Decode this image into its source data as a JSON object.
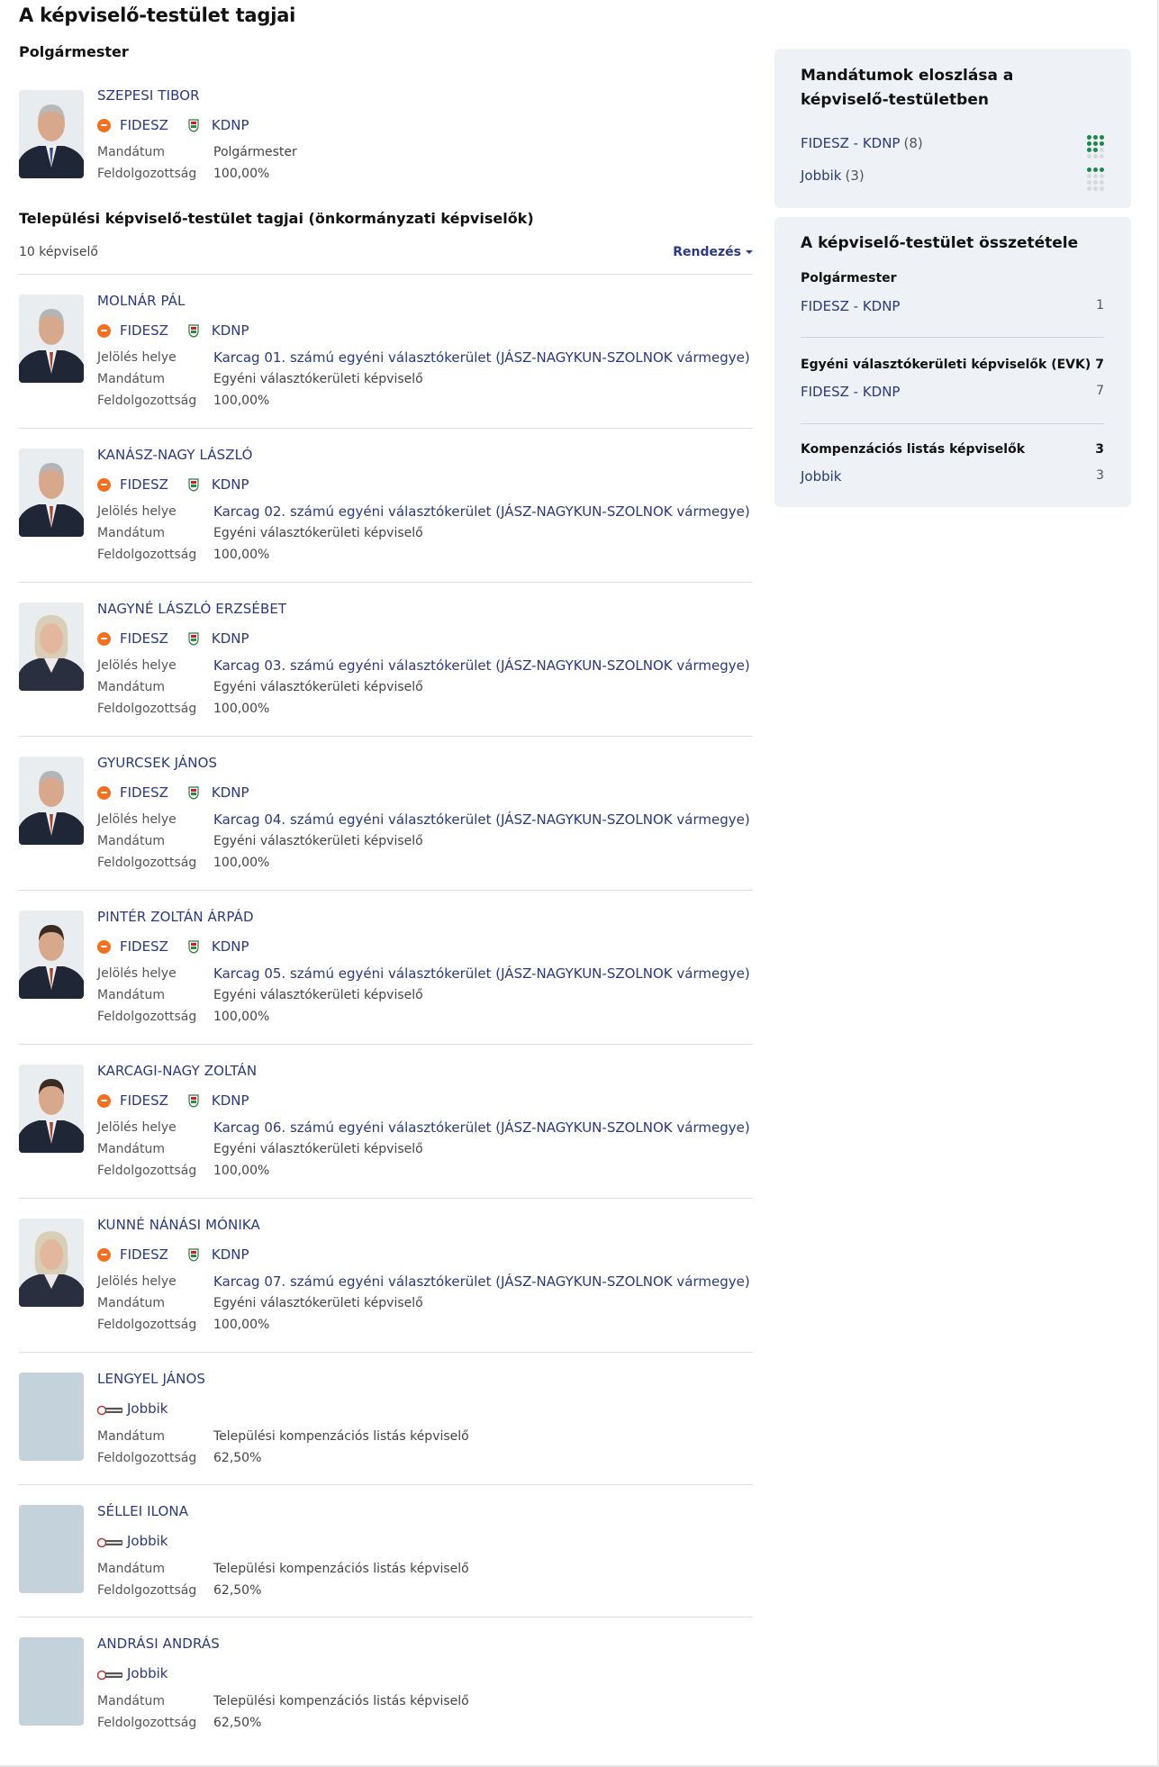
{
  "page": {
    "title": "A képviselő-testület tagjai"
  },
  "mayor_section": {
    "title": "Polgármester",
    "member": {
      "name": "SZEPESI TIBOR",
      "parties": [
        "FIDESZ",
        "KDNP"
      ],
      "mandate_label": "Mandátum",
      "mandate": "Polgármester",
      "processed_label": "Feldolgozottság",
      "processed": "100,00%"
    }
  },
  "council_section": {
    "title": "Települési képviselő-testület tagjai (önkormányzati képviselők)",
    "count_text": "10 képviselő",
    "sort_label": "Rendezés",
    "labels": {
      "nomination": "Jelölés helye",
      "mandate": "Mandátum",
      "processed": "Feldolgozottság"
    },
    "members": [
      {
        "name": "MOLNÁR PÁL",
        "parties": [
          "FIDESZ",
          "KDNP"
        ],
        "nomination": "Karcag 01. számú egyéni választókerület (JÁSZ-NAGYKUN-SZOLNOK vármegye)",
        "mandate": "Egyéni választókerületi képviselő",
        "processed": "100,00%",
        "avatar": "man-grey-hair"
      },
      {
        "name": "KANÁSZ-NAGY LÁSZLÓ",
        "parties": [
          "FIDESZ",
          "KDNP"
        ],
        "nomination": "Karcag 02. számú egyéni választókerület (JÁSZ-NAGYKUN-SZOLNOK vármegye)",
        "mandate": "Egyéni választókerületi képviselő",
        "processed": "100,00%",
        "avatar": "man-grey-hair"
      },
      {
        "name": "NAGYNÉ LÁSZLÓ ERZSÉBET",
        "parties": [
          "FIDESZ",
          "KDNP"
        ],
        "nomination": "Karcag 03. számú egyéni választókerület (JÁSZ-NAGYKUN-SZOLNOK vármegye)",
        "mandate": "Egyéni választókerületi képviselő",
        "processed": "100,00%",
        "avatar": "woman-blonde"
      },
      {
        "name": "GYURCSEK JÁNOS",
        "parties": [
          "FIDESZ",
          "KDNP"
        ],
        "nomination": "Karcag 04. számú egyéni választókerület (JÁSZ-NAGYKUN-SZOLNOK vármegye)",
        "mandate": "Egyéni választókerületi képviselő",
        "processed": "100,00%",
        "avatar": "man-grey-hair"
      },
      {
        "name": "PINTÉR ZOLTÁN ÁRPÁD",
        "parties": [
          "FIDESZ",
          "KDNP"
        ],
        "nomination": "Karcag 05. számú egyéni választókerület (JÁSZ-NAGYKUN-SZOLNOK vármegye)",
        "mandate": "Egyéni választókerületi képviselő",
        "processed": "100,00%",
        "avatar": "man-dark-hair"
      },
      {
        "name": "KARCAGI-NAGY ZOLTÁN",
        "parties": [
          "FIDESZ",
          "KDNP"
        ],
        "nomination": "Karcag 06. számú egyéni választókerület (JÁSZ-NAGYKUN-SZOLNOK vármegye)",
        "mandate": "Egyéni választókerületi képviselő",
        "processed": "100,00%",
        "avatar": "man-dark-hair"
      },
      {
        "name": "KUNNÉ NÁNÁSI MÓNIKA",
        "parties": [
          "FIDESZ",
          "KDNP"
        ],
        "nomination": "Karcag 07. számú egyéni választókerület (JÁSZ-NAGYKUN-SZOLNOK vármegye)",
        "mandate": "Egyéni választókerületi képviselő",
        "processed": "100,00%",
        "avatar": "woman-blonde"
      },
      {
        "name": "LENGYEL JÁNOS",
        "parties": [
          "Jobbik"
        ],
        "nomination": "",
        "mandate": "Települési kompenzációs listás képviselő",
        "processed": "62,50%",
        "avatar": "placeholder"
      },
      {
        "name": "SÉLLEI ILONA",
        "parties": [
          "Jobbik"
        ],
        "nomination": "",
        "mandate": "Települési kompenzációs listás képviselő",
        "processed": "62,50%",
        "avatar": "placeholder"
      },
      {
        "name": "ANDRÁSI ANDRÁS",
        "parties": [
          "Jobbik"
        ],
        "nomination": "",
        "mandate": "Települési kompenzációs listás képviselő",
        "processed": "62,50%",
        "avatar": "placeholder"
      }
    ]
  },
  "mandate_distribution": {
    "title": "Mandátumok eloszlása a képviselő-testületben",
    "items": [
      {
        "label": "FIDESZ - KDNP",
        "count_text": "(8)",
        "seats": 8
      },
      {
        "label": "Jobbik",
        "count_text": "(3)",
        "seats": 3
      }
    ],
    "total_seats": 11,
    "dot_color": "#1a8a48"
  },
  "composition": {
    "title": "A képviselő-testület összetétele",
    "groups": [
      {
        "heading": "Polgármester",
        "total": "",
        "rows": [
          {
            "party": "FIDESZ - KDNP",
            "count": "1"
          }
        ]
      },
      {
        "heading": "Egyéni választókerületi képviselők (EVK)",
        "total": "7",
        "rows": [
          {
            "party": "FIDESZ - KDNP",
            "count": "7"
          }
        ]
      },
      {
        "heading": "Kompenzációs listás képviselők",
        "total": "3",
        "rows": [
          {
            "party": "Jobbik",
            "count": "3"
          }
        ]
      }
    ]
  },
  "colors": {
    "link": "#2a3a7c",
    "fidesz": "#f37021",
    "card_bg": "#eef1f5",
    "placeholder": "#c3d2db"
  }
}
